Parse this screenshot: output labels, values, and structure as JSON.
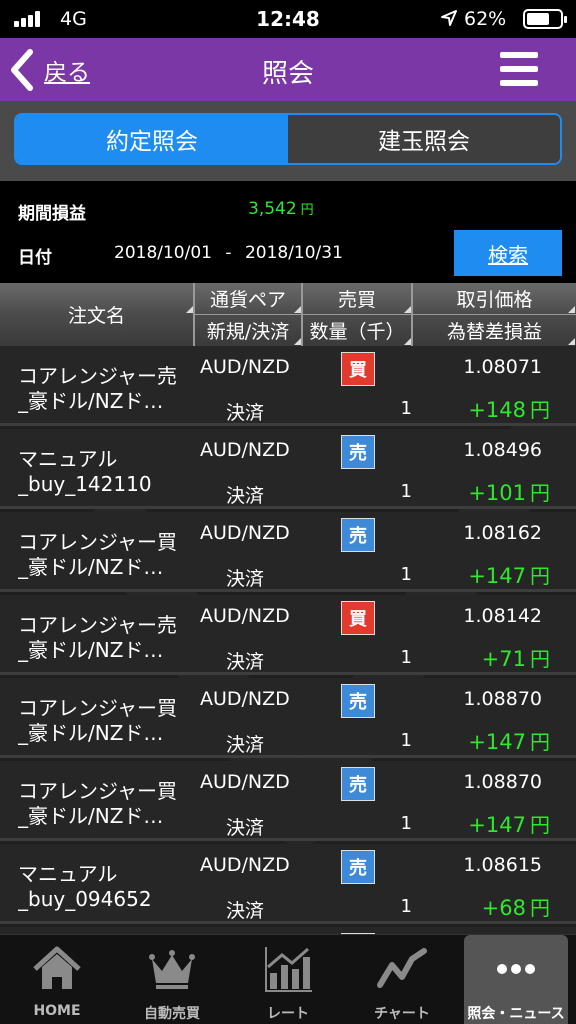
{
  "status_bar": {
    "carrier": "4G",
    "time": "12:48",
    "battery": "62%",
    "battery_level": 0.62
  },
  "nav": {
    "back_label": "戻る",
    "title": "照会"
  },
  "segments": {
    "left": "約定照会",
    "right": "建玉照会",
    "selected": "left"
  },
  "summary": {
    "pl_label": "期間損益",
    "pl_value": "3,542",
    "pl_unit": "円",
    "date_label": "日付",
    "date_from": "2018/10/01",
    "date_sep": "-",
    "date_to": "2018/10/31",
    "search_label": "検索"
  },
  "table": {
    "headers": {
      "name": "注文名",
      "pair": "通貨ペア",
      "side": "売買",
      "price": "取引価格",
      "kind": "新規/決済",
      "qty": "数量（千）",
      "pl": "為替差損益"
    },
    "rows": [
      {
        "name1": "コアレンジャー売",
        "name2": "_豪ドル/NZド…",
        "pair": "AUD/NZD",
        "kind": "決済",
        "side": "買",
        "side_type": "buy",
        "qty": "1",
        "price": "1.08071",
        "pl": "+148",
        "pl_unit": "円"
      },
      {
        "name1": "マニュアル",
        "name2": "_buy_142110",
        "pair": "AUD/NZD",
        "kind": "決済",
        "side": "売",
        "side_type": "sell",
        "qty": "1",
        "price": "1.08496",
        "pl": "+101",
        "pl_unit": "円"
      },
      {
        "name1": "コアレンジャー買",
        "name2": "_豪ドル/NZド…",
        "pair": "AUD/NZD",
        "kind": "決済",
        "side": "売",
        "side_type": "sell",
        "qty": "1",
        "price": "1.08162",
        "pl": "+147",
        "pl_unit": "円"
      },
      {
        "name1": "コアレンジャー売",
        "name2": "_豪ドル/NZド…",
        "pair": "AUD/NZD",
        "kind": "決済",
        "side": "買",
        "side_type": "buy",
        "qty": "1",
        "price": "1.08142",
        "pl": "+71",
        "pl_unit": "円"
      },
      {
        "name1": "コアレンジャー買",
        "name2": "_豪ドル/NZド…",
        "pair": "AUD/NZD",
        "kind": "決済",
        "side": "売",
        "side_type": "sell",
        "qty": "1",
        "price": "1.08870",
        "pl": "+147",
        "pl_unit": "円"
      },
      {
        "name1": "コアレンジャー買",
        "name2": "_豪ドル/NZド…",
        "pair": "AUD/NZD",
        "kind": "決済",
        "side": "売",
        "side_type": "sell",
        "qty": "1",
        "price": "1.08870",
        "pl": "+147",
        "pl_unit": "円"
      },
      {
        "name1": "マニュアル",
        "name2": "_buy_094652",
        "pair": "AUD/NZD",
        "kind": "決済",
        "side": "売",
        "side_type": "sell",
        "qty": "1",
        "price": "1.08615",
        "pl": "+68",
        "pl_unit": "円"
      }
    ]
  },
  "tabbar": {
    "items": [
      {
        "label": "HOME",
        "icon": "home-icon"
      },
      {
        "label": "自動売買",
        "icon": "crown-icon"
      },
      {
        "label": "レート",
        "icon": "rate-chart-icon"
      },
      {
        "label": "チャート",
        "icon": "line-chart-icon"
      },
      {
        "label": "照会・ニュース",
        "icon": "more-dots-icon"
      }
    ],
    "active": 4
  },
  "colors": {
    "nav_bg": "#7b37a6",
    "accent_blue": "#1e8cf0",
    "profit_green": "#2ee82e",
    "buy_red": "#e23b2e",
    "sell_blue": "#3f8ad8"
  }
}
